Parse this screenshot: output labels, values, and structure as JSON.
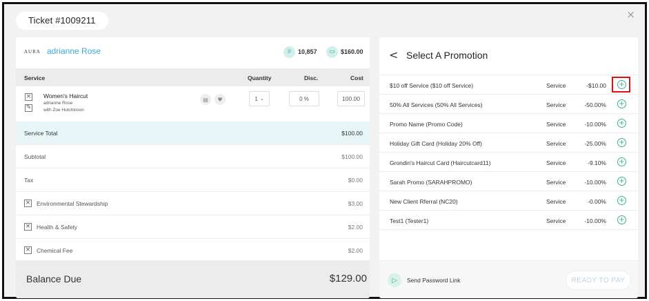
{
  "ticket": {
    "label": "Ticket #1009211",
    "close_glyph": "×"
  },
  "client": {
    "logo_text": "AURA",
    "name": "adrianne Rose",
    "points_icon": "trophy-icon",
    "points": "10,857",
    "wallet_icon": "gift-card-icon",
    "balance": "$160.00"
  },
  "table": {
    "headers": {
      "service": "Service",
      "quantity": "Quantity",
      "disc": "Disc.",
      "cost": "Cost"
    },
    "service_item": {
      "name": "Women's Haircut",
      "client": "adrianne Rose",
      "stylist": "with Zoe Hutchinson",
      "quantity": "1",
      "discount": "0 %",
      "cost": "100.00"
    }
  },
  "summary": {
    "service_total_label": "Service Total",
    "service_total": "$100.00",
    "subtotal_label": "Subtotal",
    "subtotal": "$100.00",
    "tax_label": "Tax",
    "tax": "$0.00",
    "fees": [
      {
        "label": "Environmental Stewardship",
        "value": "$3.00"
      },
      {
        "label": "Health & Safety",
        "value": "$2.00"
      },
      {
        "label": "Chemical Fee",
        "value": "$2.00"
      }
    ],
    "balance_due_label": "Balance Due",
    "balance_due": "$129.00"
  },
  "promotions": {
    "title": "Select A Promotion",
    "back_glyph": "<",
    "items": [
      {
        "name": "$10 off Service ($10 off Service)",
        "type": "Service",
        "amount": "-$10.00"
      },
      {
        "name": "50% All Services (50% All Services)",
        "type": "Service",
        "amount": "-50.00%"
      },
      {
        "name": "Promo Name (Promo Code)",
        "type": "Service",
        "amount": "-10.00%"
      },
      {
        "name": "Holiday Gift Card (Holiday 20% Off)",
        "type": "Service",
        "amount": "-25.00%"
      },
      {
        "name": "Grondin's Haircut Card (Haircutcard11)",
        "type": "Service",
        "amount": "-9.10%"
      },
      {
        "name": "Sarah Promo  (SARAHPROMO)",
        "type": "Service",
        "amount": "-10.00%"
      },
      {
        "name": "New Client Rferral (NC20)",
        "type": "Service",
        "amount": "-0.00%"
      },
      {
        "name": "Test1 (Tester1)",
        "type": "Service",
        "amount": "-10.00%"
      }
    ]
  },
  "footer": {
    "send_link_label": "Send Password Link",
    "ready_label": "READY TO PAY"
  }
}
